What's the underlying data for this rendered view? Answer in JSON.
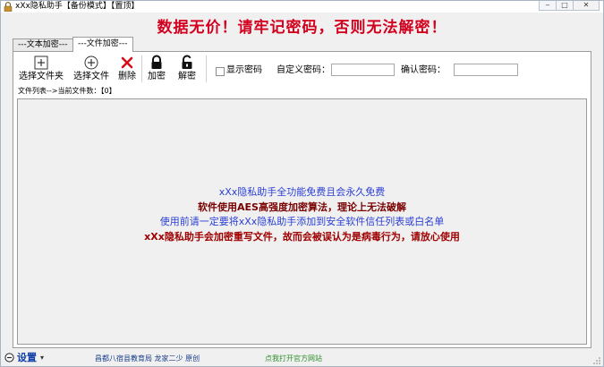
{
  "window": {
    "title": "xXx隐私助手【备份模式】【置顶】",
    "controls": {
      "minimize": "‒",
      "maximize": "□",
      "close": "✕"
    }
  },
  "slogan": "数据无价！请牢记密码，否则无法解密！",
  "tabs": [
    {
      "label": "---文本加密---",
      "active": false
    },
    {
      "label": "---文件加密---",
      "active": true
    }
  ],
  "toolbar": {
    "select_folder": "选择文件夹",
    "select_file": "选择文件",
    "delete": "删除",
    "encrypt": "加密",
    "decrypt": "解密",
    "show_password": "显示密码",
    "custom_password_label": "自定义密码：",
    "confirm_password_label": "确认密码：",
    "custom_password_value": "",
    "confirm_password_value": ""
  },
  "status": {
    "file_list_label": "文件列表-->当前文件数：【0】"
  },
  "notices": [
    {
      "text": "xXx隐私助手全功能免费且会永久免费",
      "color": "#2b3fd4",
      "bold": false
    },
    {
      "text": "软件使用AES高强度加密算法，理论上无法破解",
      "color": "#7a0000",
      "bold": true
    },
    {
      "text": "使用前请一定要将xXx隐私助手添加到安全软件信任列表或白名单",
      "color": "#2b3fd4",
      "bold": false
    },
    {
      "text": "xXx隐私助手会加密重写文件，故而会被误认为是病毒行为，请放心使用",
      "color": "#a00000",
      "bold": true
    }
  ],
  "footer": {
    "settings": "设置",
    "credit": "昌都八宿县教育局 龙家二少 原创",
    "website": "点我打开官方网站"
  },
  "colors": {
    "slogan": "#d2001e",
    "settings": "#1240a8",
    "website": "#2f8f2f"
  }
}
